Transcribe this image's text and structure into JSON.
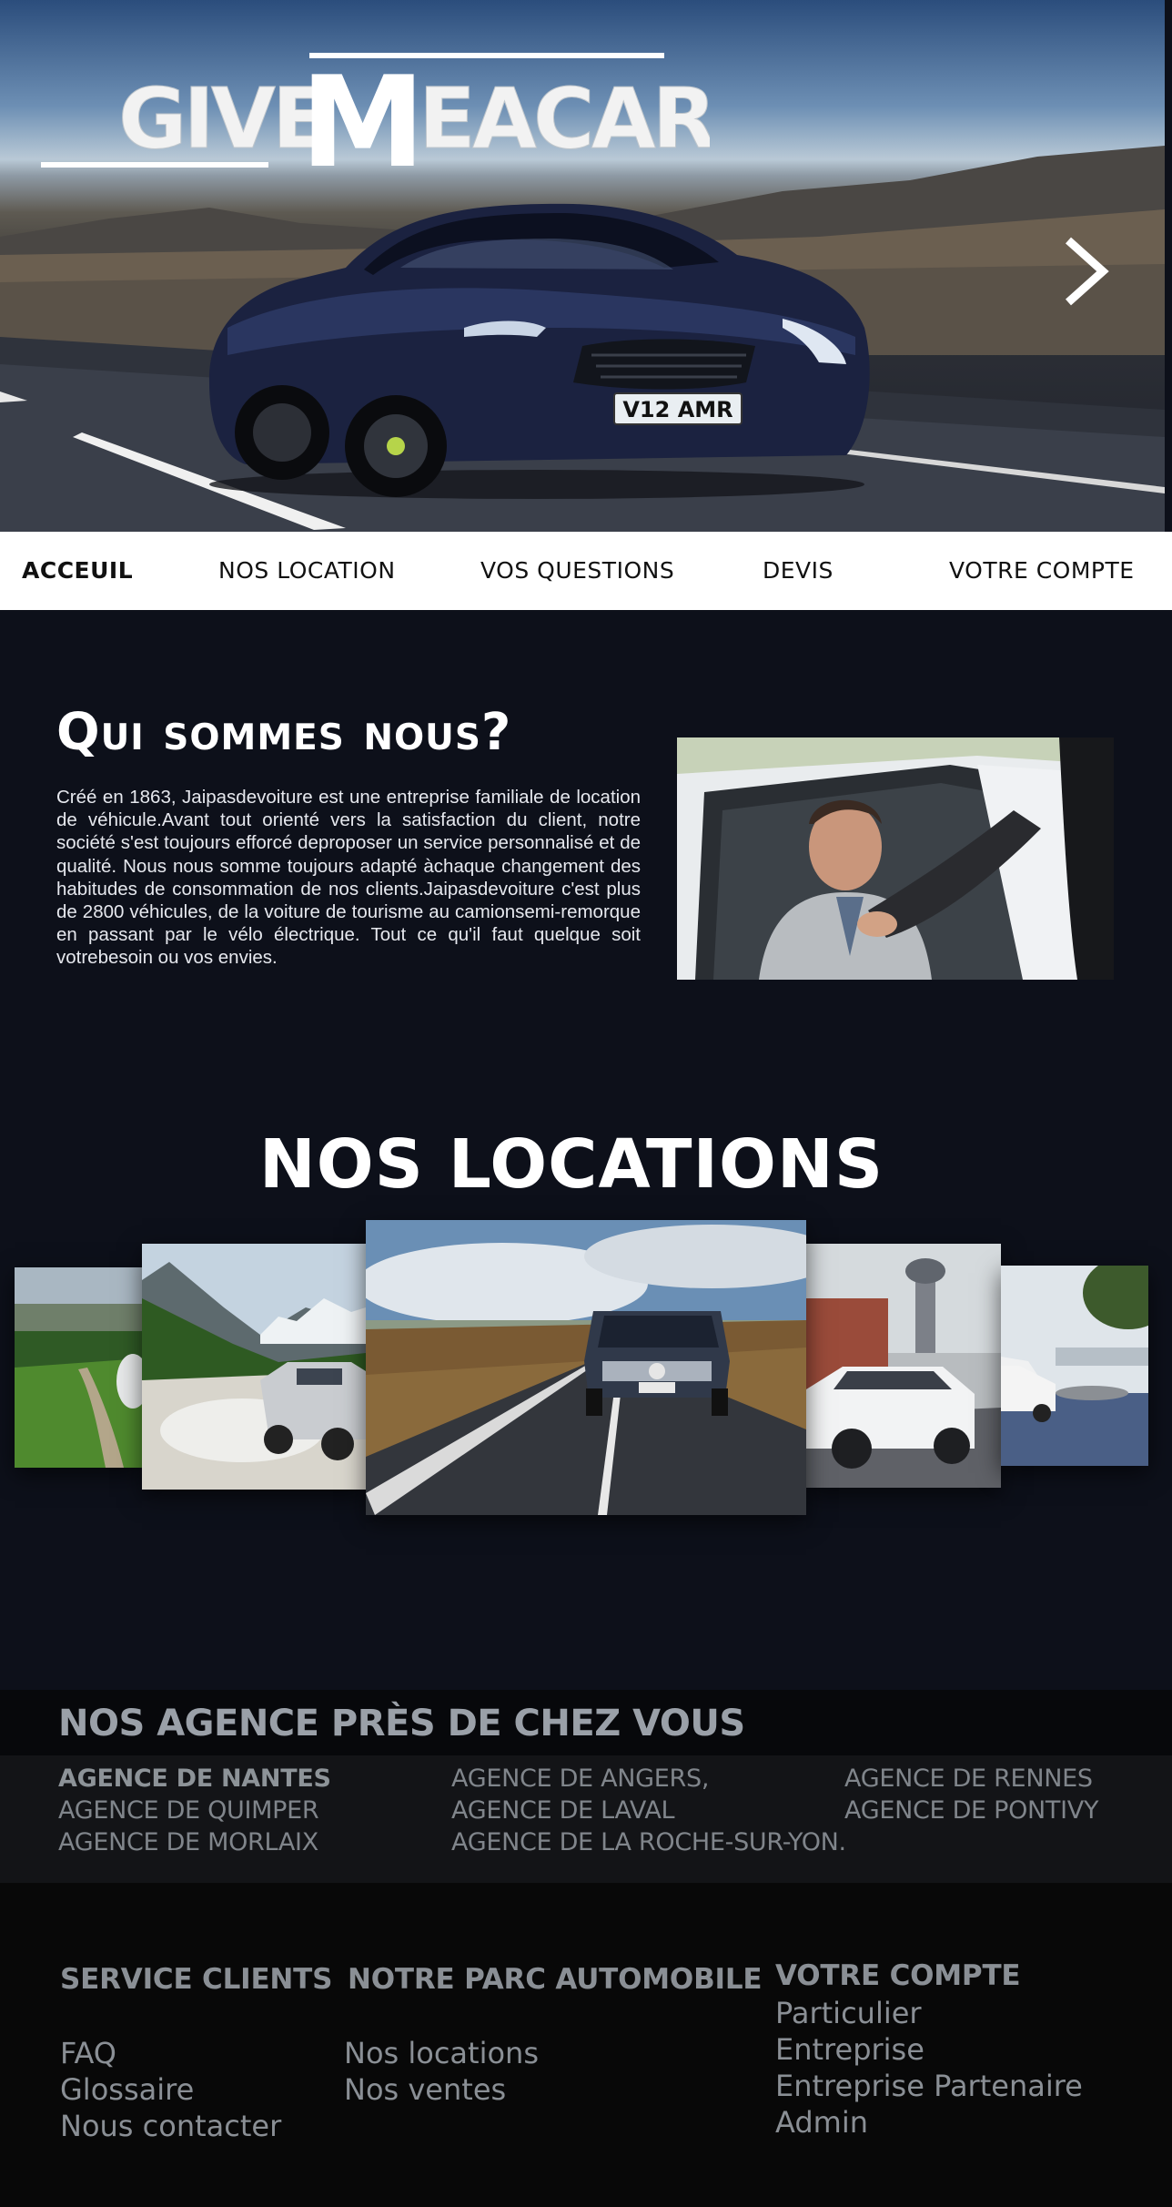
{
  "hero": {
    "logo_text": "GIVEMEACAR",
    "plate_text": "V12 AMR",
    "next_icon": "chevron-right-icon"
  },
  "nav": {
    "items": [
      {
        "label": "ACCEUIL",
        "active": true
      },
      {
        "label": "NOS LOCATION",
        "active": false
      },
      {
        "label": "VOS QUESTIONS",
        "active": false
      },
      {
        "label": "DEVIS",
        "active": false
      },
      {
        "label": "VOTRE COMPTE",
        "active": false
      }
    ]
  },
  "about": {
    "title": "Qui sommes nous?",
    "text": "Créé en 1863, Jaipasdevoiture est une entreprise familiale de location de véhicule.Avant tout orienté vers la satisfaction du client, notre société s'est toujours efforcé deproposer un service personnalisé et de qualité. Nous nous somme toujours adapté àchaque changement des habitudes de consommation de nos clients.Jaipasdevoiture c'est plus de 2800 véhicules, de la voiture de tourisme au camionsemi-remorque en passant par le vélo électrique. Tout ce qu'il faut quelque soit votrebesoin ou vos envies."
  },
  "locations": {
    "title": "NOS LOCATIONS"
  },
  "agencies": {
    "title": "NOS AGENCE PRÈS DE CHEZ VOUS",
    "items": [
      "AGENCE DE NANTES",
      "AGENCE DE QUIMPER",
      "AGENCE DE MORLAIX",
      "AGENCE DE ANGERS,",
      "AGENCE DE LAVAL",
      "AGENCE DE LA ROCHE-SUR-YON.",
      "AGENCE DE RENNES",
      "AGENCE DE PONTIVY"
    ]
  },
  "footer": {
    "service": {
      "title": "SERVICE CLIENTS",
      "links": [
        "FAQ",
        "Glossaire",
        "Nous contacter"
      ]
    },
    "parc": {
      "title": "NOTRE PARC AUTOMOBILE",
      "links": [
        "Nos locations",
        "Nos ventes"
      ]
    },
    "account": {
      "title": "VOTRE COMPTE",
      "links": [
        "Particulier",
        "Entreprise",
        "Entreprise Partenaire",
        "Admin"
      ]
    }
  },
  "colors": {
    "page_bg": "#0d101a",
    "nav_bg": "#ffffff",
    "muted_text": "#8a8f95"
  }
}
